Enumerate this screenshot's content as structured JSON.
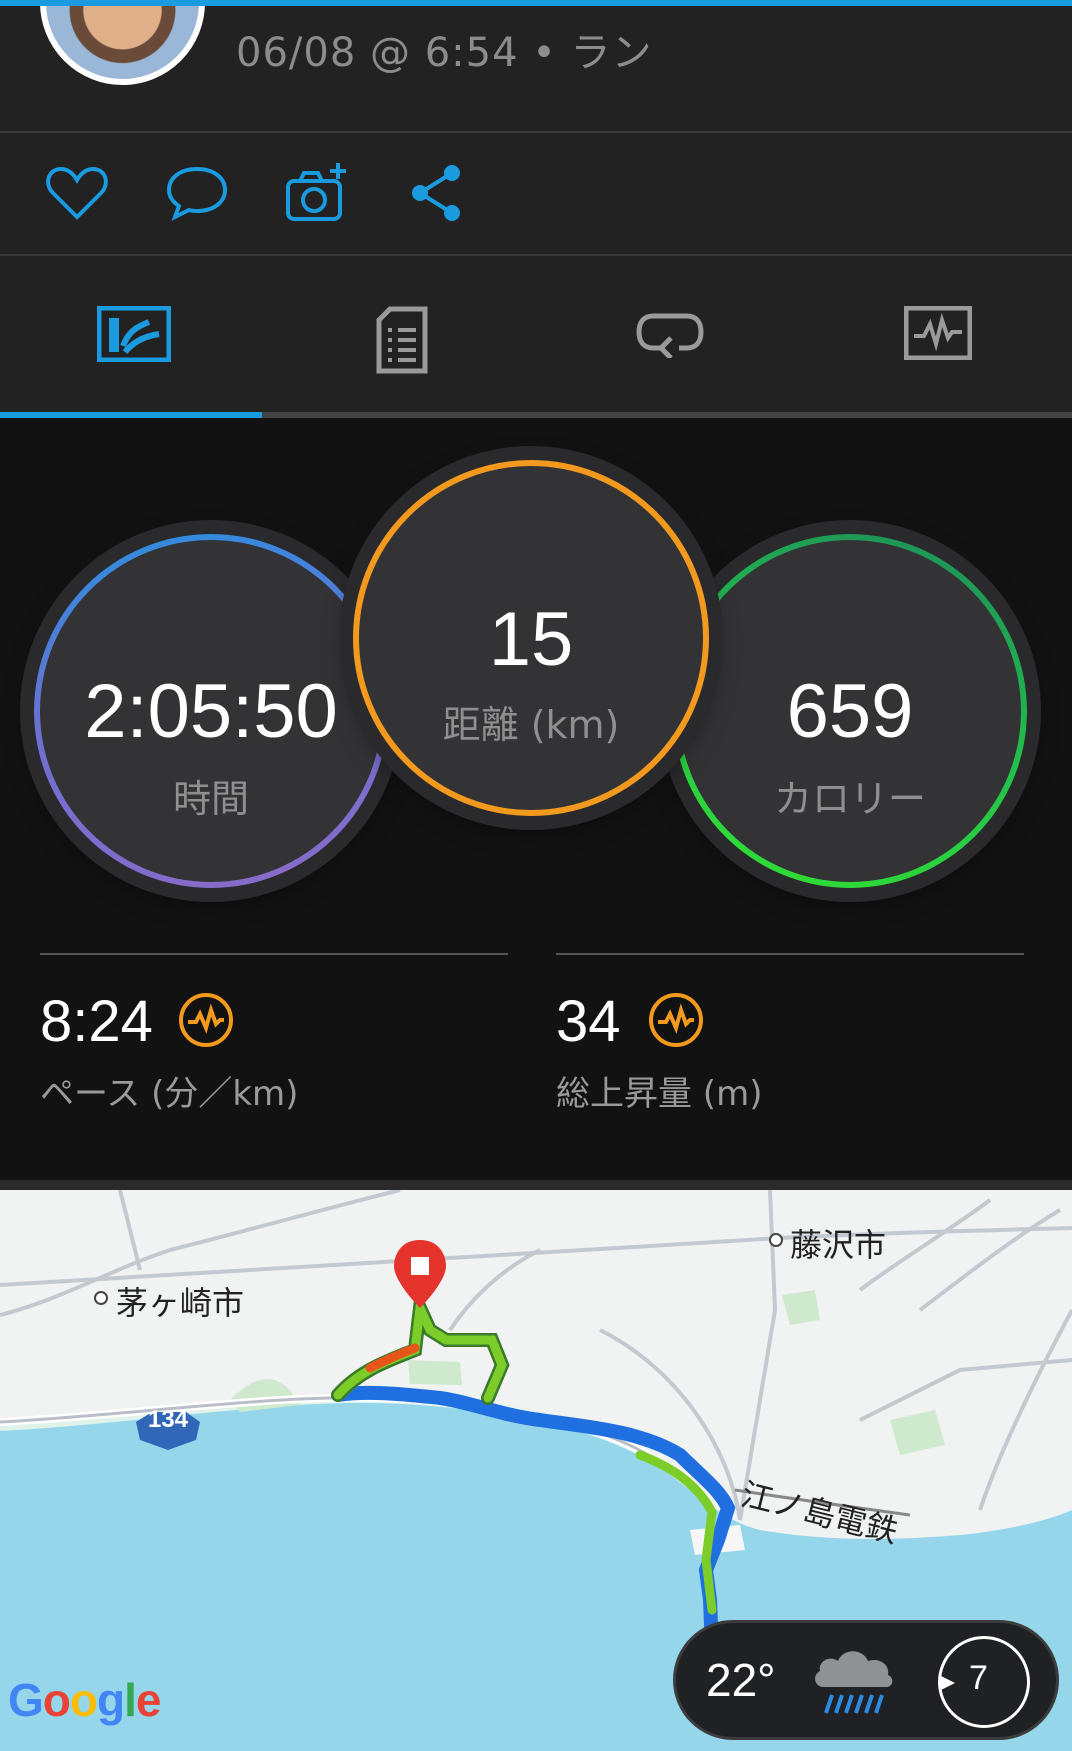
{
  "header": {
    "meta": "06/08 @ 6:54 • ラン"
  },
  "actions": {
    "like": "heart-icon",
    "comment": "comment-icon",
    "photo": "add-photo-icon",
    "share": "share-icon"
  },
  "tabs": [
    {
      "name": "overview",
      "icon": "overview-icon",
      "active": true
    },
    {
      "name": "details",
      "icon": "document-icon",
      "active": false
    },
    {
      "name": "laps",
      "icon": "laps-icon",
      "active": false
    },
    {
      "name": "charts",
      "icon": "chart-icon",
      "active": false
    }
  ],
  "stats": {
    "time": {
      "value": "2:05:50",
      "label": "時間"
    },
    "distance": {
      "value": "15",
      "label": "距離 (km)"
    },
    "calories": {
      "value": "659",
      "label": "カロリー"
    },
    "pace": {
      "value": "8:24",
      "label": "ペース (分／km)"
    },
    "ascent": {
      "value": "34",
      "label": "総上昇量 (m)"
    }
  },
  "map": {
    "label_fujisawa": "藤沢市",
    "label_chigasaki": "茅ヶ崎市",
    "label_enoden": "江ノ島電鉄",
    "road_number": "134",
    "attribution": "Google"
  },
  "weather": {
    "temp": "22°",
    "condition": "rain-cloud-icon",
    "wind": "7"
  },
  "colors": {
    "accent": "#1a9be0",
    "time_ring": "#6e6fd0",
    "distance_ring": "#f39a1e",
    "calories_ring": "#22c24a",
    "icon_orange": "#f39a1e"
  }
}
